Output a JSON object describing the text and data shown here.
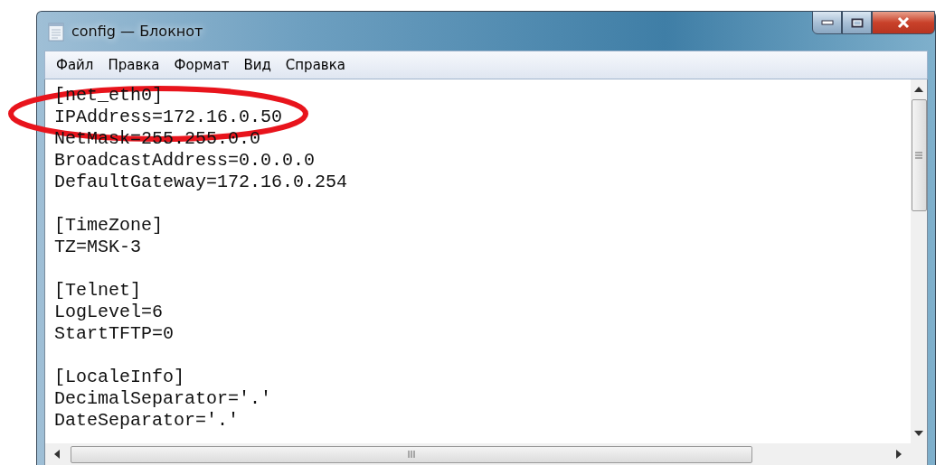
{
  "window": {
    "title": "config — Блокнот"
  },
  "menu": [
    {
      "label": "Файл"
    },
    {
      "label": "Правка"
    },
    {
      "label": "Формат"
    },
    {
      "label": "Вид"
    },
    {
      "label": "Справка"
    }
  ],
  "editor": {
    "sections": [
      {
        "lines": [
          "[net_eth0]",
          "IPAddress=172.16.0.50",
          "NetMask=255.255.0.0",
          "BroadcastAddress=0.0.0.0",
          "DefaultGateway=172.16.0.254"
        ]
      },
      {
        "lines": [
          "[TimeZone]",
          "TZ=MSK-3"
        ]
      },
      {
        "lines": [
          "[Telnet]",
          "LogLevel=6",
          "StartTFTP=0"
        ]
      },
      {
        "lines": [
          "[LocaleInfo]",
          "DecimalSeparator='.'",
          "DateSeparator='.'"
        ]
      }
    ]
  },
  "highlight": {
    "color": "#e8141c"
  }
}
